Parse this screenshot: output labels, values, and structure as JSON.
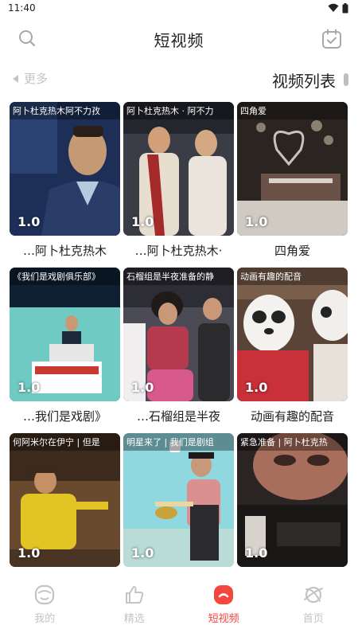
{
  "status_bar": {
    "time": "11:40"
  },
  "header": {
    "title": "短视频"
  },
  "subbar": {
    "more_label": "更多",
    "list_title": "视频列表"
  },
  "videos": [
    {
      "caption": "阿卜杜克热木阿不力孜",
      "score": "1.0",
      "title": "…阿卜杜克热木"
    },
    {
      "caption": "阿卜杜克热木 · 阿不力",
      "score": "1.0",
      "title": "…阿卜杜克热木·"
    },
    {
      "caption": "四角爱",
      "score": "1.0",
      "title": "四角爱"
    },
    {
      "caption": "《我们是戏剧俱乐部》",
      "score": "1.0",
      "title": "…我们是戏剧》"
    },
    {
      "caption": "石榴组是半夜准备的静",
      "score": "1.0",
      "title": "…石榴组是半夜"
    },
    {
      "caption": "动画有趣的配音",
      "score": "1.0",
      "title": "动画有趣的配音"
    },
    {
      "caption": "何阿米尔在伊宁 | 但是",
      "score": "1.0",
      "title": ""
    },
    {
      "caption": "明星来了 | 我们是剧组",
      "score": "1.0",
      "title": ""
    },
    {
      "caption": "紧急准备 | 阿卜杜克热",
      "score": "1.0",
      "title": ""
    }
  ],
  "tabs": [
    {
      "label": "我的",
      "icon": "face-icon",
      "active": false
    },
    {
      "label": "精选",
      "icon": "thumbs-up-icon",
      "active": false
    },
    {
      "label": "短视频",
      "icon": "short-video-icon",
      "active": true
    },
    {
      "label": "首页",
      "icon": "planet-icon",
      "active": false
    }
  ],
  "colors": {
    "accent": "#f2463f",
    "inactive": "#c4c4c4"
  }
}
